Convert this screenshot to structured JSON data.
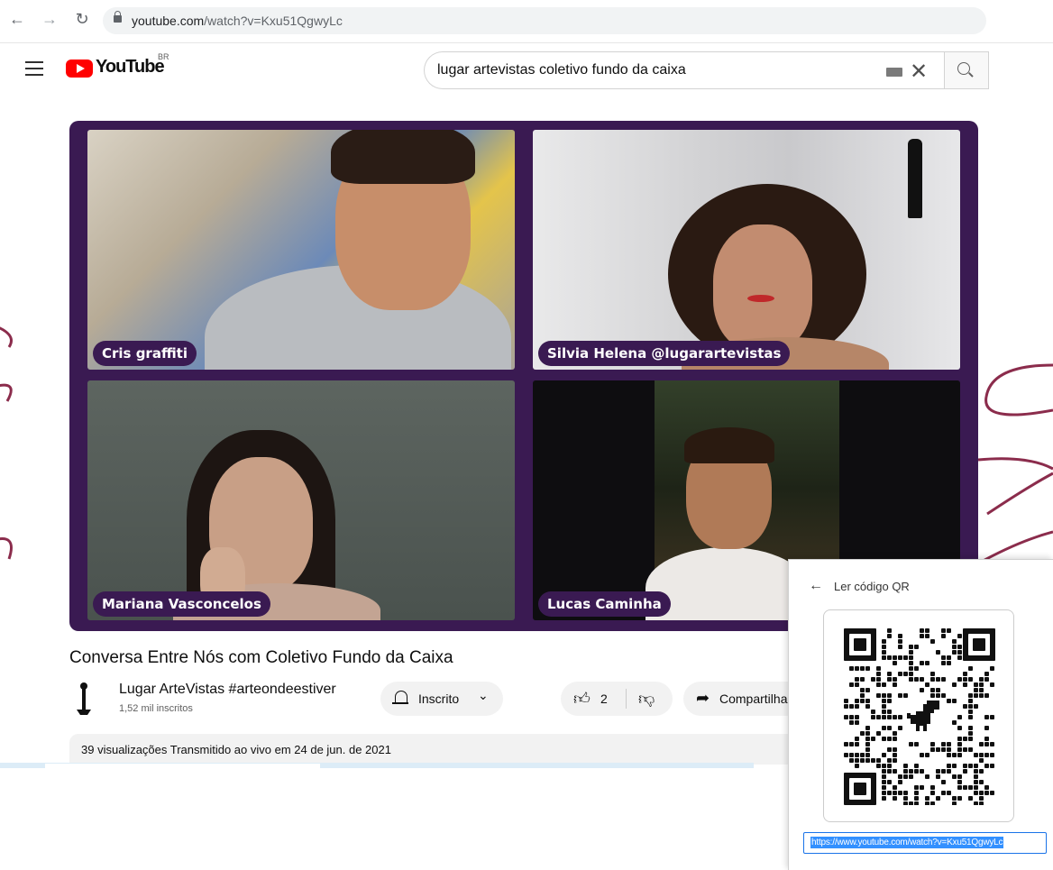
{
  "browser": {
    "url_host": "youtube.com",
    "url_path": "/watch?v=Kxu51QgwyLc"
  },
  "header": {
    "logo_text": "YouTube",
    "country_code": "BR",
    "search_query": "lugar artevistas coletivo fundo da caixa"
  },
  "player": {
    "participants": [
      "Cris graffiti",
      "Silvia Helena @lugarartevistas",
      "Mariana Vasconcelos",
      "Lucas Caminha"
    ],
    "frame_color": "#3a1a52"
  },
  "video": {
    "title": "Conversa Entre Nós com Coletivo Fundo da Caixa",
    "channel_name": "Lugar ArteVistas #arteondeestiver",
    "subscribers": "1,52 mil inscritos",
    "subscribe_label": "Inscrito",
    "like_count": "2",
    "share_label": "Compartilhar",
    "description": "39 visualizações  Transmitido ao vivo em 24 de jun. de 2021"
  },
  "qr_panel": {
    "title": "Ler código QR",
    "url": "https://www.youtube.com/watch?v=Kxu51QgwyLc"
  },
  "icons": {
    "back": "arrow-left",
    "forward": "arrow-right",
    "reload": "reload",
    "menu": "hamburger",
    "search": "magnifier",
    "bell": "bell",
    "like": "thumbs-up",
    "dislike": "thumbs-down",
    "share": "share-arrow",
    "qr_center": "dinosaur"
  },
  "colors": {
    "brand_red": "#ff0000",
    "deco_curve": "#8b2c4c",
    "selection": "#3390ff"
  }
}
